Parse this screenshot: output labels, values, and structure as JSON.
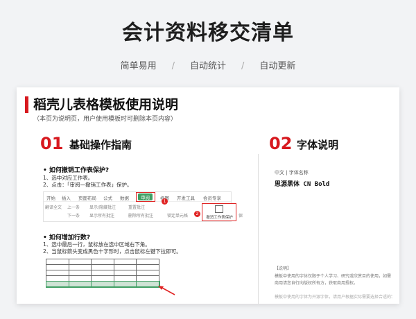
{
  "header": {
    "title": "会计资料移交清单",
    "features": [
      "简单易用",
      "自动统计",
      "自动更新"
    ],
    "separator": "/"
  },
  "doc": {
    "title": "稻壳儿表格模板使用说明",
    "note": "（本页为说明页，用户使用模板时可删除本页内容）"
  },
  "section1": {
    "number": "01",
    "title": "基础操作指南",
    "q1": {
      "title": "•  如何撤销工作表保护?",
      "steps": [
        "1、选中对应工作表。",
        "2、点击：「审阅—撤销工作表」保护。"
      ]
    },
    "ribbon": {
      "tabs": [
        "开始",
        "插入",
        "页面布局",
        "公式",
        "数据",
        "审阅",
        "视图",
        "开发工具",
        "会员专享"
      ],
      "active_tab": "审阅",
      "tools": [
        "翻译全文",
        "上一条",
        "显示/隐藏批注",
        "重置批注",
        "下一条",
        "显示所有批注",
        "删除所有批注",
        "锁定单元格"
      ],
      "badge1": "1",
      "badge2": "2",
      "unprotect_label": "撤消工作表保护",
      "trailing": "保"
    },
    "q2": {
      "title": "•  如何增加行数?",
      "steps": [
        "1、选中最后一行，鼠标放在选中区域右下角。",
        "2、当鼠标箭头变成黑色十字形时，点击鼠标左键下拉即可。"
      ]
    }
  },
  "section2": {
    "number": "02",
    "title": "字体说明",
    "meta": "中文 | 字体名称",
    "font_name": "思源黑体 CN Bold",
    "note_label": "【说明】",
    "note_text": "模板中使用的字体仅限于个人学习、研究或欣赏目的使用，如需商用请您自行向版权所有方，获取商用授权。",
    "note_faded": "模板中使用的字体为开源字体，请用户根据实际需要选择合适的字体使用。"
  },
  "colors": {
    "accent": "#d7191f",
    "green": "#3f9e63"
  }
}
